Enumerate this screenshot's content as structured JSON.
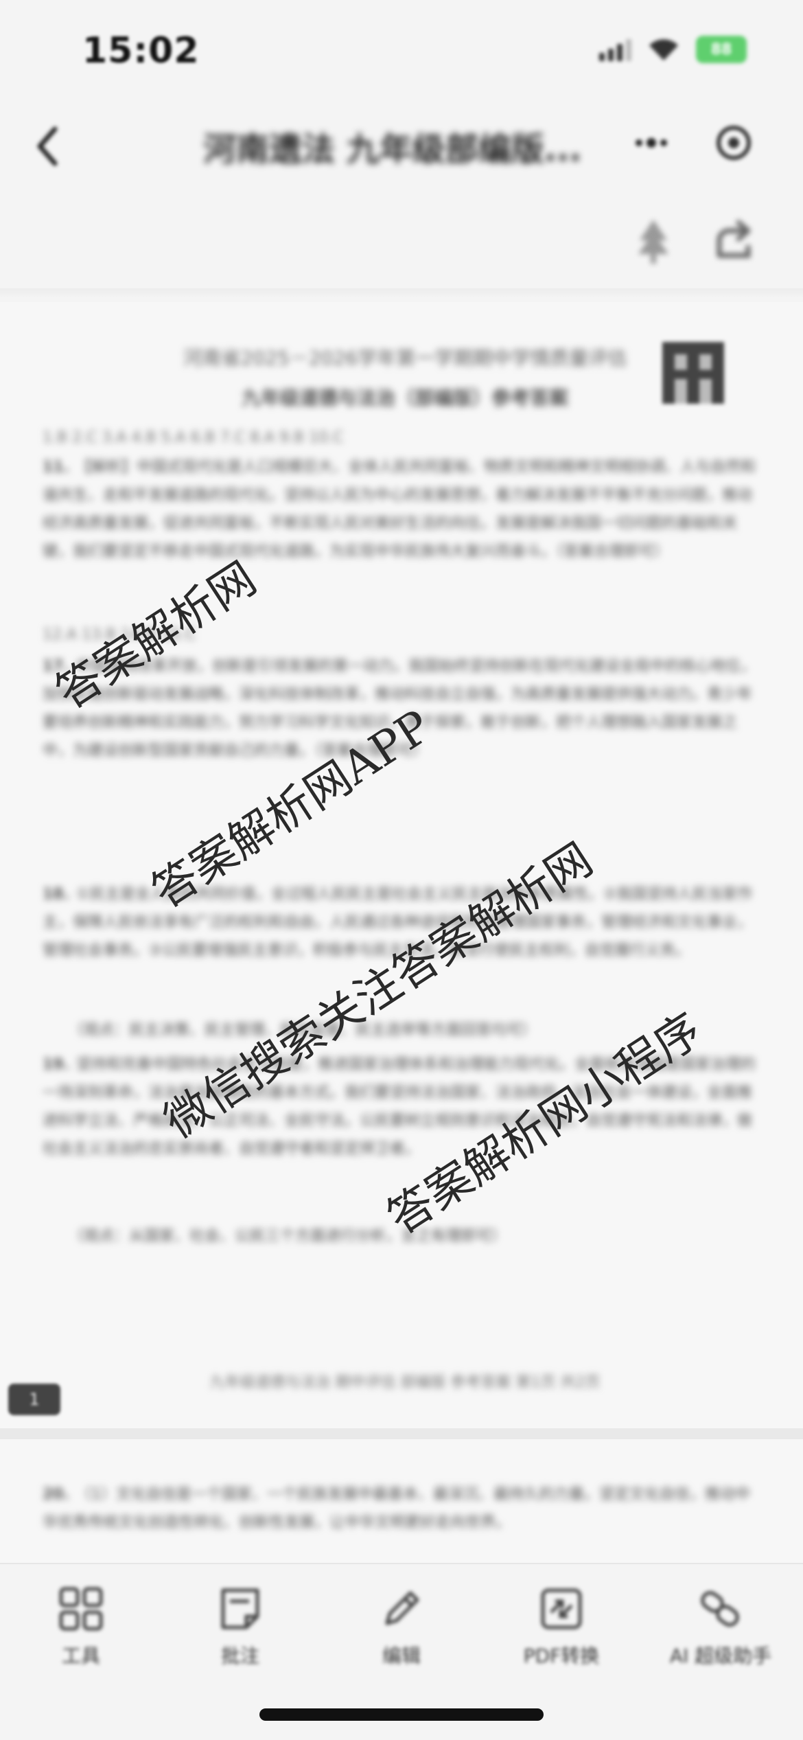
{
  "status_bar": {
    "time": "15:02",
    "battery_label": "88"
  },
  "nav": {
    "title": "河南遗法 九年级部编版..."
  },
  "document": {
    "title": "河南省2025－2026学年第一学期期中学情质量评估",
    "subtitle": "九年级道德与法治（部编版）参考答案",
    "section_label_1": "1.B 2.C 3.A 4.B 5.A 6.B 7.C 8.A 9.B 10.C",
    "q11": {
      "number": "11.",
      "text": "【解析】中国式现代化是人口规模巨大、全体人民共同富裕、物质文明和精神文明相协调、人与自然和谐共生、走和平发展道路的现代化。坚持以人民为中心的发展思想，着力解决发展不平衡不充分问题，推动经济高质量发展，促进共同富裕，不断实现人民对美好生活的向往。发展是解决我国一切问题的基础和关键，我们要坚定不移走中国式现代化道路，为实现中华民族伟大复兴而奋斗。（答案合理即可）"
    },
    "section_label_2": "12.A 13.B 14.D 15.C",
    "q17": {
      "number": "17.",
      "text": "中国坚持改革开放，创新是引领发展的第一动力。我国始终坚持创新在现代化建设全局中的核心地位，加快实施创新驱动发展战略，深化科技体制改革，推动科技自立自强，为高质量发展提供强大动力。青少年要培养创新精神和实践能力，努力学习科学文化知识，勇于探索，敢于创新，把个人理想融入国家发展之中，为建设创新型国家贡献自己的力量。（答案合理即可）"
    },
    "q18": {
      "number": "18.",
      "text": "①民主是全人类的共同价值，全过程人民民主是社会主义民主政治的本质属性。②我国坚持人民当家作主，保障人民依法享有广泛的权利和自由，人民通过各种途径和形式管理国家事务，管理经济和文化事业，管理社会事务。③公民要增强民主意识，积极参与民主生活，依法行使民主权利，自觉履行义务。"
    },
    "q18_note": "（观点：民主决策、民主管理、民主监督、民主选举等方面回答均可）",
    "q19": {
      "number": "19.",
      "text": "坚持和完善中国特色社会主义制度，推进国家治理体系和治理能力现代化。全面依法治国是国家治理的一场深刻革命，法治是治国理政的基本方式。我们要坚持法治国家、法治政府、法治社会一体建设，全面推进科学立法、严格执法、公正司法、全民守法。公民要树立规则意识和法治观念，自觉遵守宪法和法律，做社会主义法治的忠实崇尚者、自觉遵守者和坚定捍卫者。"
    },
    "q19_note": "（观点：从国家、社会、公民三个方面进行分析，言之有理即可）",
    "footer": "九年级道德与法治 期中评估 部编版 参考答案 第1页 共2页",
    "page_badge": "1",
    "q20": {
      "number": "20.",
      "text": "（1）文化自信是一个国家、一个民族发展中最基本、最深沉、最持久的力量。坚定文化自信，推动中华优秀传统文化创造性转化、创新性发展，让中华文明更好走向世界。"
    }
  },
  "watermarks": [
    "答案解析网",
    "答案解析网APP",
    "微信搜索关注答案解析网",
    "答案解析网小程序"
  ],
  "bottom_bar": [
    {
      "label": "工具",
      "icon": "grid-icon"
    },
    {
      "label": "批注",
      "icon": "note-icon"
    },
    {
      "label": "编辑",
      "icon": "pencil-icon"
    },
    {
      "label": "PDF转换",
      "icon": "pdf-convert-icon"
    },
    {
      "label": "AI 超级助手",
      "icon": "link-icon"
    }
  ]
}
